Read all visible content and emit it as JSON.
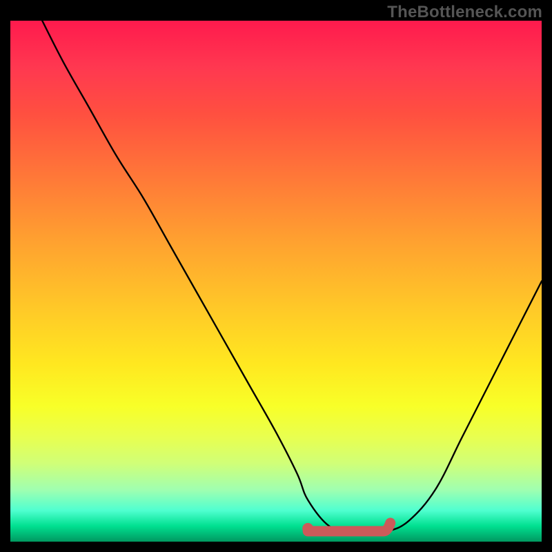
{
  "attribution": "TheBottleneck.com",
  "chart_data": {
    "type": "line",
    "title": "",
    "xlabel": "",
    "ylabel": "",
    "xlim": [
      0,
      100
    ],
    "ylim": [
      0,
      100
    ],
    "series": [
      {
        "name": "bottleneck-curve",
        "x": [
          6,
          10,
          15,
          20,
          25,
          30,
          35,
          40,
          45,
          50,
          54,
          56,
          60,
          64,
          68,
          71,
          75,
          80,
          85,
          90,
          95,
          100
        ],
        "y": [
          100,
          92,
          83,
          74,
          66,
          57,
          48,
          39,
          30,
          21,
          13,
          8,
          3,
          2,
          2,
          2,
          4,
          10,
          20,
          30,
          40,
          50
        ]
      }
    ],
    "highlight": {
      "name": "optimal-range",
      "x_start": 56,
      "x_end": 71,
      "y": 2,
      "color": "#cc5a5a"
    }
  },
  "gradient_stops": [
    {
      "pos": 0,
      "color": "#ff1a4d"
    },
    {
      "pos": 9,
      "color": "#ff3850"
    },
    {
      "pos": 18,
      "color": "#ff5040"
    },
    {
      "pos": 30,
      "color": "#ff7838"
    },
    {
      "pos": 42,
      "color": "#ffa030"
    },
    {
      "pos": 55,
      "color": "#ffc828"
    },
    {
      "pos": 66,
      "color": "#ffe820"
    },
    {
      "pos": 74,
      "color": "#f8ff28"
    },
    {
      "pos": 80,
      "color": "#e8ff50"
    },
    {
      "pos": 85,
      "color": "#d0ff78"
    },
    {
      "pos": 90,
      "color": "#a0ffb0"
    },
    {
      "pos": 94,
      "color": "#50ffd0"
    },
    {
      "pos": 97,
      "color": "#00e090"
    },
    {
      "pos": 100,
      "color": "#009860"
    }
  ]
}
